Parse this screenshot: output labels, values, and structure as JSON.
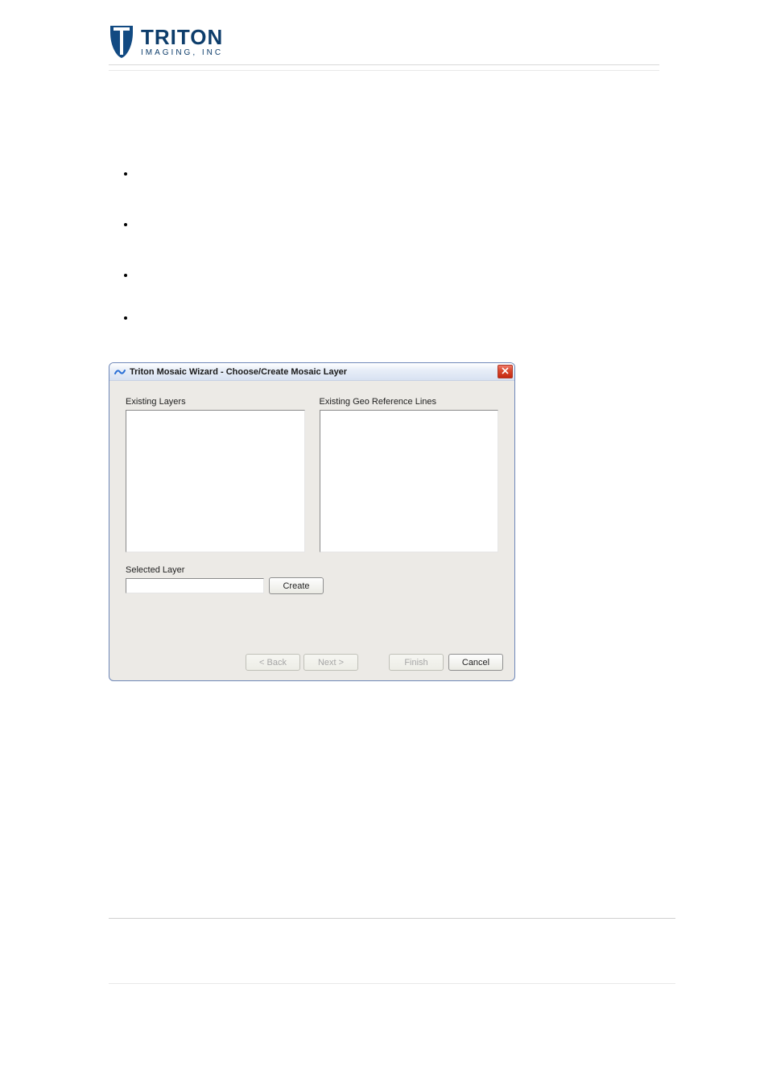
{
  "logo": {
    "name": "TRITON",
    "sub": "IMAGING, INC"
  },
  "bullets": [
    "",
    "",
    "",
    ""
  ],
  "dialog": {
    "title": "Triton Mosaic Wizard - Choose/Create Mosaic Layer",
    "existing_layers_label": "Existing Layers",
    "existing_geo_label": "Existing Geo Reference Lines",
    "selected_layer_label": "Selected Layer",
    "selected_layer_value": "",
    "create_label": "Create",
    "back_label": "< Back",
    "next_label": "Next >",
    "finish_label": "Finish",
    "cancel_label": "Cancel"
  }
}
